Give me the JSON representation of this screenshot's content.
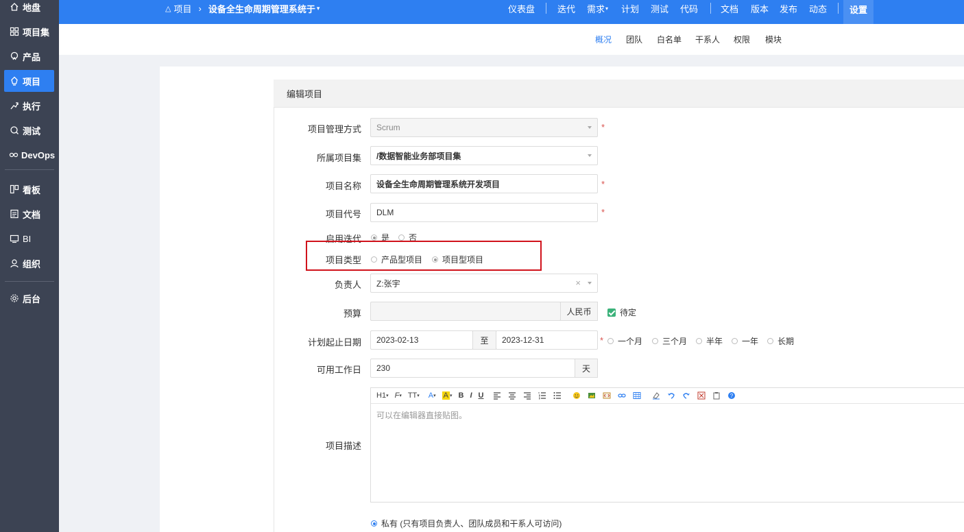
{
  "sidebar": {
    "items": [
      {
        "label": "地盘",
        "icon": "home-icon"
      },
      {
        "label": "项目集",
        "icon": "grid-icon"
      },
      {
        "label": "产品",
        "icon": "product-icon"
      },
      {
        "label": "项目",
        "icon": "project-icon"
      },
      {
        "label": "执行",
        "icon": "run-icon"
      },
      {
        "label": "测试",
        "icon": "test-icon"
      },
      {
        "label": "DevOps",
        "icon": "infinity-icon"
      },
      {
        "label": "看板",
        "icon": "kanban-icon"
      },
      {
        "label": "文档",
        "icon": "doc-icon"
      },
      {
        "label": "BI",
        "icon": "monitor-icon"
      },
      {
        "label": "组织",
        "icon": "user-icon"
      },
      {
        "label": "后台",
        "icon": "gear-icon"
      }
    ]
  },
  "topbar": {
    "breadcrumb_root": "项目",
    "breadcrumb_current": "设备全生命周期管理系统于",
    "nav": [
      "仪表盘",
      "迭代",
      "需求",
      "计划",
      "测试",
      "代码",
      "文档",
      "版本",
      "发布",
      "动态"
    ],
    "settings": "设置"
  },
  "subnav": [
    "概况",
    "团队",
    "白名单",
    "干系人",
    "权限",
    "模块"
  ],
  "form": {
    "heading": "编辑项目",
    "labels": {
      "method": "项目管理方式",
      "program": "所属项目集",
      "name": "项目名称",
      "code": "项目代号",
      "iteration": "启用迭代",
      "type": "项目类型",
      "owner": "负责人",
      "budget": "预算",
      "dates": "计划起止日期",
      "workdays": "可用工作日",
      "desc": "项目描述"
    },
    "method_value": "Scrum",
    "program_value": "/数据智能业务部项目集",
    "name_value": "设备全生命周期管理系统开发项目",
    "code_value": "DLM",
    "iteration_yes": "是",
    "iteration_no": "否",
    "type_product": "产品型项目",
    "type_project": "项目型项目",
    "owner_value": "Z:张宇",
    "budget_currency": "人民币",
    "budget_pending": "待定",
    "start_date": "2023-02-13",
    "date_sep": "至",
    "end_date": "2023-12-31",
    "duration_options": [
      "一个月",
      "三个月",
      "半年",
      "一年",
      "长期"
    ],
    "workdays_value": "230",
    "workdays_unit": "天",
    "editor_placeholder": "可以在编辑器直接贴图。",
    "editor_toolbar": [
      "H1",
      "F",
      "TT",
      "A",
      "A",
      "B",
      "I",
      "U"
    ],
    "access_private": "私有 (只有项目负责人、团队成员和干系人可访问)"
  },
  "colors": {
    "accent": "#2e7ff1",
    "sidebar": "#3c4353",
    "highlight": "#d0121b"
  }
}
